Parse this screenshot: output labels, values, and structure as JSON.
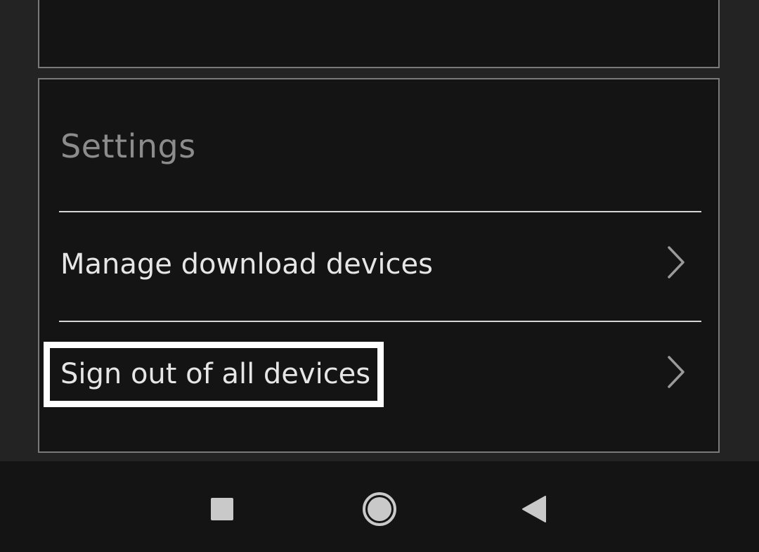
{
  "settings": {
    "title": "Settings",
    "items": [
      {
        "label": "Manage download devices",
        "icon": "chevron-right-icon"
      },
      {
        "label": "Sign out of all devices",
        "icon": "chevron-right-icon",
        "highlighted": true
      }
    ]
  },
  "navbar": {
    "recents_icon": "square-icon",
    "home_icon": "circle-icon",
    "back_icon": "triangle-left-icon"
  },
  "colors": {
    "background": "#232323",
    "card": "#141414",
    "card_border": "#7a7a7a",
    "title_text": "#8c8c8c",
    "item_text": "#e6e6e6",
    "highlight": "#ffffff"
  }
}
